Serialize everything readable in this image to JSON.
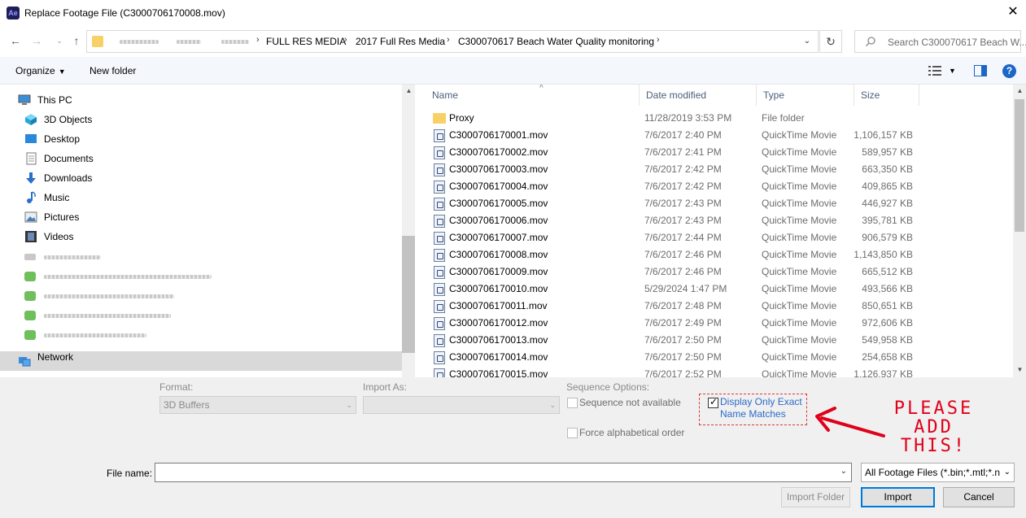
{
  "window": {
    "title": "Replace Footage File (C3000706170008.mov)",
    "app_icon": "Ae"
  },
  "address": {
    "crumbs": [
      "FULL RES MEDIA",
      "2017 Full Res Media",
      "C300070617 Beach Water Quality monitoring"
    ],
    "search_placeholder": "Search C300070617 Beach W..."
  },
  "toolbar": {
    "organize": "Organize",
    "new_folder": "New folder",
    "help": "?"
  },
  "tree": {
    "items": [
      {
        "label": "This PC",
        "icon": "pc-icon"
      },
      {
        "label": "3D Objects",
        "icon": "cube-icon"
      },
      {
        "label": "Desktop",
        "icon": "desktop-icon"
      },
      {
        "label": "Documents",
        "icon": "documents-icon"
      },
      {
        "label": "Downloads",
        "icon": "download-icon"
      },
      {
        "label": "Music",
        "icon": "music-icon"
      },
      {
        "label": "Pictures",
        "icon": "pictures-icon"
      },
      {
        "label": "Videos",
        "icon": "videos-icon"
      }
    ],
    "network": "Network"
  },
  "columns": {
    "name": "Name",
    "date": "Date modified",
    "type": "Type",
    "size": "Size"
  },
  "files": [
    {
      "name": "Proxy",
      "date": "11/28/2019 3:53 PM",
      "type": "File folder",
      "size": "",
      "kind": "folder"
    },
    {
      "name": "C3000706170001.mov",
      "date": "7/6/2017 2:40 PM",
      "type": "QuickTime Movie",
      "size": "1,106,157 KB",
      "kind": "file"
    },
    {
      "name": "C3000706170002.mov",
      "date": "7/6/2017 2:41 PM",
      "type": "QuickTime Movie",
      "size": "589,957 KB",
      "kind": "file"
    },
    {
      "name": "C3000706170003.mov",
      "date": "7/6/2017 2:42 PM",
      "type": "QuickTime Movie",
      "size": "663,350 KB",
      "kind": "file"
    },
    {
      "name": "C3000706170004.mov",
      "date": "7/6/2017 2:42 PM",
      "type": "QuickTime Movie",
      "size": "409,865 KB",
      "kind": "file"
    },
    {
      "name": "C3000706170005.mov",
      "date": "7/6/2017 2:43 PM",
      "type": "QuickTime Movie",
      "size": "446,927 KB",
      "kind": "file"
    },
    {
      "name": "C3000706170006.mov",
      "date": "7/6/2017 2:43 PM",
      "type": "QuickTime Movie",
      "size": "395,781 KB",
      "kind": "file"
    },
    {
      "name": "C3000706170007.mov",
      "date": "7/6/2017 2:44 PM",
      "type": "QuickTime Movie",
      "size": "906,579 KB",
      "kind": "file"
    },
    {
      "name": "C3000706170008.mov",
      "date": "7/6/2017 2:46 PM",
      "type": "QuickTime Movie",
      "size": "1,143,850 KB",
      "kind": "file"
    },
    {
      "name": "C3000706170009.mov",
      "date": "7/6/2017 2:46 PM",
      "type": "QuickTime Movie",
      "size": "665,512 KB",
      "kind": "file"
    },
    {
      "name": "C3000706170010.mov",
      "date": "5/29/2024 1:47 PM",
      "type": "QuickTime Movie",
      "size": "493,566 KB",
      "kind": "file"
    },
    {
      "name": "C3000706170011.mov",
      "date": "7/6/2017 2:48 PM",
      "type": "QuickTime Movie",
      "size": "850,651 KB",
      "kind": "file"
    },
    {
      "name": "C3000706170012.mov",
      "date": "7/6/2017 2:49 PM",
      "type": "QuickTime Movie",
      "size": "972,606 KB",
      "kind": "file"
    },
    {
      "name": "C3000706170013.mov",
      "date": "7/6/2017 2:50 PM",
      "type": "QuickTime Movie",
      "size": "549,958 KB",
      "kind": "file"
    },
    {
      "name": "C3000706170014.mov",
      "date": "7/6/2017 2:50 PM",
      "type": "QuickTime Movie",
      "size": "254,658 KB",
      "kind": "file"
    },
    {
      "name": "C3000706170015.mov",
      "date": "7/6/2017 2:52 PM",
      "type": "QuickTime Movie",
      "size": "1,126,937 KB",
      "kind": "file"
    }
  ],
  "options": {
    "format_label": "Format:",
    "format_value": "3D Buffers",
    "import_as_label": "Import As:",
    "import_as_value": "",
    "sequence_label": "Sequence Options:",
    "sequence_cb": "Sequence not available",
    "exact_line1": "Display Only Exact",
    "exact_line2": "Name Matches",
    "alpha_cb": "Force alphabetical order",
    "note": "PLEASE ADD THIS!"
  },
  "bottom": {
    "filename_label": "File name:",
    "filename_value": "",
    "filter": "All Footage Files (*.bin;*.mtl;*.n",
    "import_folder": "Import Folder",
    "import": "Import",
    "cancel": "Cancel"
  },
  "colors": {
    "accent": "#0078d7",
    "annotation": "#e0001a",
    "folder": "#f7d067",
    "link": "#2a6bc9"
  }
}
